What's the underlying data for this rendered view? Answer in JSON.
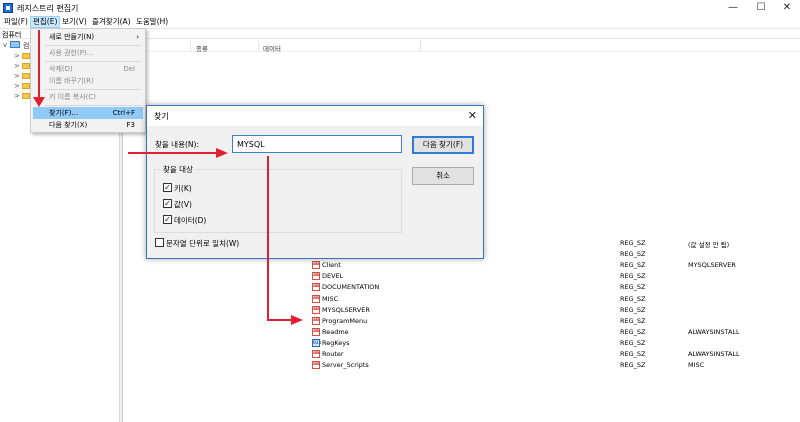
{
  "window": {
    "title": "레지스트리 편집기",
    "minimize": "—",
    "maximize": "☐",
    "close": "✕"
  },
  "menubar": [
    "파일(F)",
    "편집(E)",
    "보기(V)",
    "즐겨찾기(A)",
    "도움말(H)"
  ],
  "address": "컴퓨터",
  "tree": {
    "root": "컴"
  },
  "list": {
    "columns": {
      "type": "종류",
      "data": "데이터"
    },
    "rows": [
      {
        "name": "",
        "type": "REG_SZ",
        "data": "(값 설정 안 됨)",
        "icon": "ab"
      },
      {
        "name": "",
        "type": "REG_SZ",
        "data": "",
        "icon": "ab"
      },
      {
        "name": "Client",
        "type": "REG_SZ",
        "data": "MYSQLSERVER",
        "icon": "ab"
      },
      {
        "name": "DEVEL",
        "type": "REG_SZ",
        "data": "",
        "icon": "ab"
      },
      {
        "name": "DOCUMENTATION",
        "type": "REG_SZ",
        "data": "",
        "icon": "ab"
      },
      {
        "name": "MISC",
        "type": "REG_SZ",
        "data": "",
        "icon": "ab"
      },
      {
        "name": "MYSQLSERVER",
        "type": "REG_SZ",
        "data": "",
        "icon": "ab"
      },
      {
        "name": "ProgramMenu",
        "type": "REG_SZ",
        "data": "",
        "icon": "ab"
      },
      {
        "name": "Readme",
        "type": "REG_SZ",
        "data": "ALWAYSINSTALL",
        "icon": "ab"
      },
      {
        "name": "RegKeys",
        "type": "REG_SZ",
        "data": "",
        "icon": "bin"
      },
      {
        "name": "Router",
        "type": "REG_SZ",
        "data": "ALWAYSINSTALL",
        "icon": "ab"
      },
      {
        "name": "Server_Scripts",
        "type": "REG_SZ",
        "data": "MISC",
        "icon": "ab"
      }
    ]
  },
  "edit_menu": {
    "items": [
      {
        "label": "새로 만들기(N)",
        "shortcut": "",
        "submenu": true,
        "disabled": false
      },
      {
        "label": "사용 권한(P)...",
        "shortcut": "",
        "submenu": false,
        "disabled": true
      },
      {
        "label": "삭제(D)",
        "shortcut": "Del",
        "submenu": false,
        "disabled": true
      },
      {
        "label": "이름 바꾸기(R)",
        "shortcut": "",
        "submenu": false,
        "disabled": true
      },
      {
        "label": "키 이름 복사(C)",
        "shortcut": "",
        "submenu": false,
        "disabled": true
      },
      {
        "label": "찾기(F)...",
        "shortcut": "Ctrl+F",
        "submenu": false,
        "disabled": false,
        "highlighted": true
      },
      {
        "label": "다음 찾기(X)",
        "shortcut": "F3",
        "submenu": false,
        "disabled": false
      }
    ]
  },
  "find_dialog": {
    "title": "찾기",
    "close": "✕",
    "find_label": "찾을 내용(N):",
    "find_value": "MYSQL",
    "group_label": "찾을 대상",
    "options": [
      {
        "label": "키(K)",
        "checked": true,
        "mark": "✓"
      },
      {
        "label": "값(V)",
        "checked": true,
        "mark": "✓"
      },
      {
        "label": "데이터(D)",
        "checked": true,
        "mark": "✓"
      }
    ],
    "match_whole": {
      "label": "문자열 단위로 일치(W)",
      "checked": false,
      "mark": ""
    },
    "find_next_button": "다음 찾기(F)",
    "cancel_button": "취소"
  },
  "colors": {
    "annotation_arrow": "#e02030",
    "dialog_border": "#3a74c5",
    "menu_highlight": "#91c9f7"
  }
}
